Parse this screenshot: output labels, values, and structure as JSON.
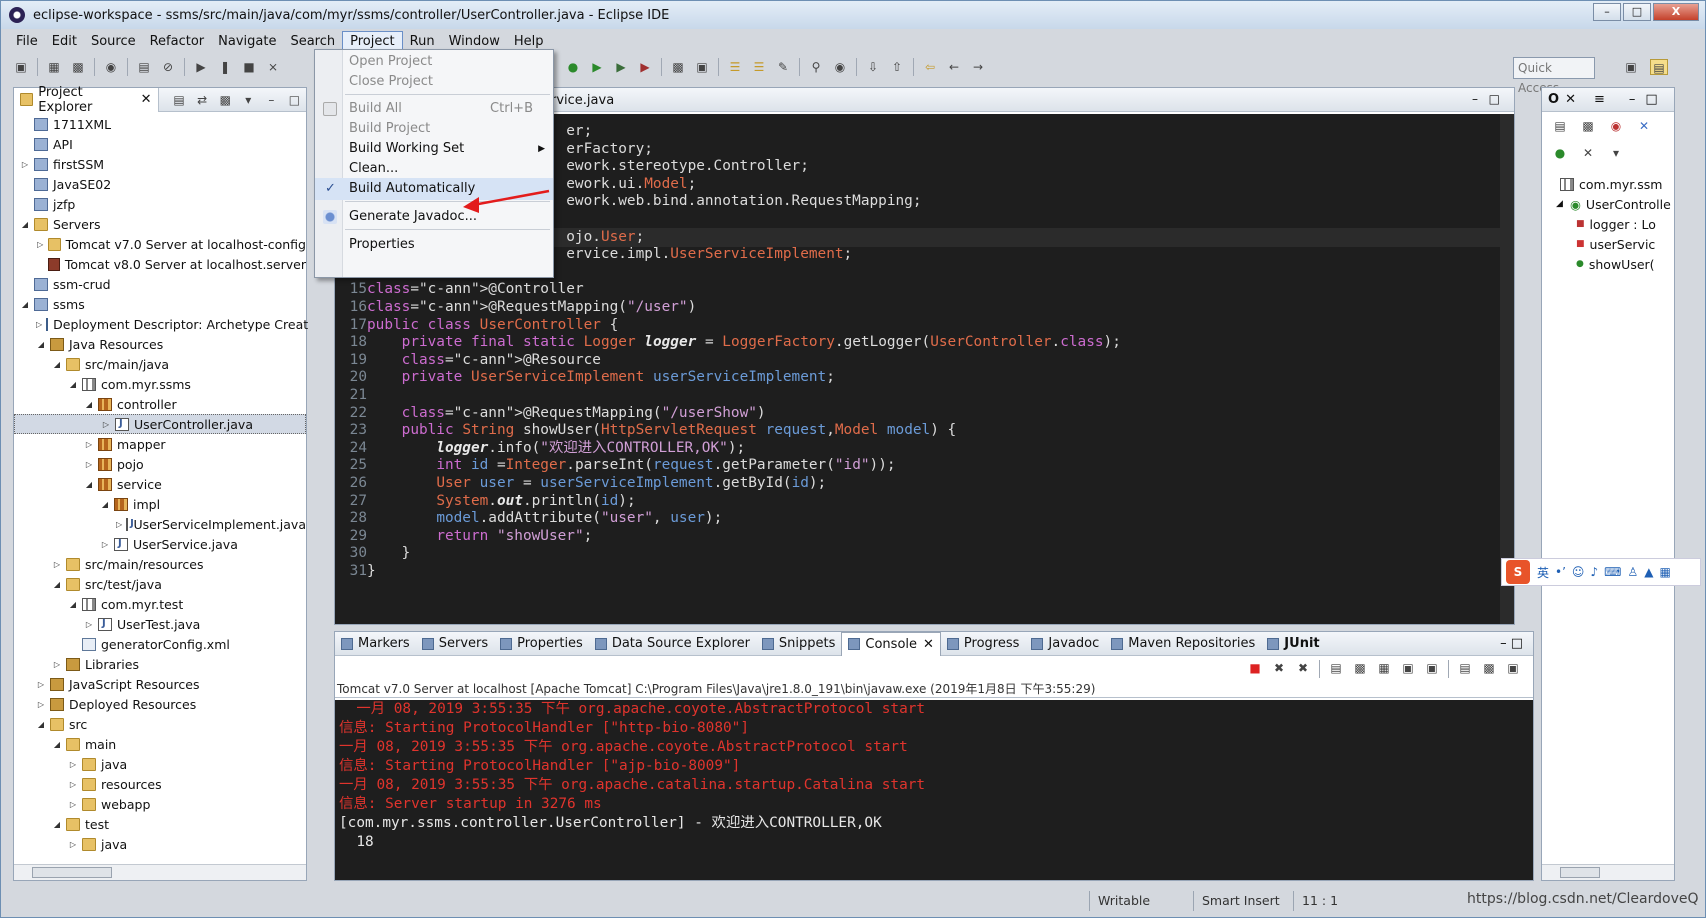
{
  "window": {
    "title": "eclipse-workspace - ssms/src/main/java/com/myr/ssms/controller/UserController.java - Eclipse IDE",
    "buttons": [
      "–",
      "□",
      "X"
    ]
  },
  "menubar": [
    "File",
    "Edit",
    "Source",
    "Refactor",
    "Navigate",
    "Search",
    "Project",
    "Run",
    "Window",
    "Help"
  ],
  "quick_access": "Quick Access",
  "project_menu": {
    "items": [
      {
        "label": "Open Project",
        "disabled": true
      },
      {
        "label": "Close Project",
        "disabled": true
      },
      {
        "label": "Build All",
        "accel": "Ctrl+B",
        "disabled": true
      },
      {
        "label": "Build Project",
        "disabled": true
      },
      {
        "label": "Build Working Set",
        "submenu": true
      },
      {
        "label": "Clean..."
      },
      {
        "label": "Build Automatically",
        "checked": true
      },
      {
        "label": "Generate Javadoc..."
      },
      {
        "label": "Properties"
      }
    ]
  },
  "explorer": {
    "title": "Project Explorer",
    "tree": [
      {
        "label": "1711XML",
        "depth": 0,
        "twisty": "",
        "icon": "project"
      },
      {
        "label": "API",
        "depth": 0,
        "twisty": "",
        "icon": "project"
      },
      {
        "label": "firstSSM",
        "depth": 0,
        "twisty": ">",
        "icon": "project"
      },
      {
        "label": "JavaSE02",
        "depth": 0,
        "twisty": "",
        "icon": "project"
      },
      {
        "label": "jzfp",
        "depth": 0,
        "twisty": "",
        "icon": "project"
      },
      {
        "label": "Servers",
        "depth": 0,
        "twisty": "v",
        "icon": "folder"
      },
      {
        "label": "Tomcat v7.0 Server at localhost-config",
        "depth": 1,
        "twisty": ">",
        "icon": "folder"
      },
      {
        "label": "Tomcat v8.0 Server at localhost.server",
        "depth": 1,
        "twisty": "",
        "icon": "server"
      },
      {
        "label": "ssm-crud",
        "depth": 0,
        "twisty": "",
        "icon": "project"
      },
      {
        "label": "ssms",
        "depth": 0,
        "twisty": "v",
        "icon": "project"
      },
      {
        "label": "Deployment Descriptor: Archetype Creat",
        "depth": 1,
        "twisty": ">",
        "icon": "desc"
      },
      {
        "label": "Java Resources",
        "depth": 1,
        "twisty": "v",
        "icon": "lib"
      },
      {
        "label": "src/main/java",
        "depth": 2,
        "twisty": "v",
        "icon": "folder"
      },
      {
        "label": "com.myr.ssms",
        "depth": 3,
        "twisty": "v",
        "icon": "pkgw"
      },
      {
        "label": "controller",
        "depth": 4,
        "twisty": "v",
        "icon": "pkg"
      },
      {
        "label": "UserController.java",
        "depth": 5,
        "twisty": ">",
        "icon": "java",
        "selected": true
      },
      {
        "label": "mapper",
        "depth": 4,
        "twisty": ">",
        "icon": "pkg"
      },
      {
        "label": "pojo",
        "depth": 4,
        "twisty": ">",
        "icon": "pkg"
      },
      {
        "label": "service",
        "depth": 4,
        "twisty": "v",
        "icon": "pkg"
      },
      {
        "label": "impl",
        "depth": 5,
        "twisty": "v",
        "icon": "pkg"
      },
      {
        "label": "UserServiceImplement.java",
        "depth": 6,
        "twisty": ">",
        "icon": "java"
      },
      {
        "label": "UserService.java",
        "depth": 5,
        "twisty": ">",
        "icon": "java"
      },
      {
        "label": "src/main/resources",
        "depth": 2,
        "twisty": ">",
        "icon": "folder"
      },
      {
        "label": "src/test/java",
        "depth": 2,
        "twisty": "v",
        "icon": "folder"
      },
      {
        "label": "com.myr.test",
        "depth": 3,
        "twisty": "v",
        "icon": "pkgw"
      },
      {
        "label": "UserTest.java",
        "depth": 4,
        "twisty": ">",
        "icon": "java"
      },
      {
        "label": "generatorConfig.xml",
        "depth": 3,
        "twisty": "",
        "icon": "xml"
      },
      {
        "label": "Libraries",
        "depth": 2,
        "twisty": ">",
        "icon": "lib"
      },
      {
        "label": "JavaScript Resources",
        "depth": 1,
        "twisty": ">",
        "icon": "lib"
      },
      {
        "label": "Deployed Resources",
        "depth": 1,
        "twisty": ">",
        "icon": "lib"
      },
      {
        "label": "src",
        "depth": 1,
        "twisty": "v",
        "icon": "folder"
      },
      {
        "label": "main",
        "depth": 2,
        "twisty": "v",
        "icon": "folder"
      },
      {
        "label": "java",
        "depth": 3,
        "twisty": ">",
        "icon": "folder"
      },
      {
        "label": "resources",
        "depth": 3,
        "twisty": ">",
        "icon": "folder"
      },
      {
        "label": "webapp",
        "depth": 3,
        "twisty": ">",
        "icon": "folder"
      },
      {
        "label": "test",
        "depth": 2,
        "twisty": "v",
        "icon": "folder"
      },
      {
        "label": "java",
        "depth": 3,
        "twisty": ">",
        "icon": "folder"
      }
    ]
  },
  "editor": {
    "tab_title": "rvice.java",
    "lines": [
      {
        "n": "",
        "code": "                       er;"
      },
      {
        "n": "",
        "code": "                       erFactory;"
      },
      {
        "n": "",
        "code": "                       ework.stereotype.Controller;"
      },
      {
        "n": "",
        "code": "                       ework.ui.Model;"
      },
      {
        "n": "",
        "code": "                       ework.web.bind.annotation.RequestMapping;"
      },
      {
        "n": "",
        "code": ""
      },
      {
        "n": "",
        "code": "                       ojo.User;"
      },
      {
        "n": "",
        "code": "                       ervice.impl.UserServiceImplement;"
      },
      {
        "n": "14",
        "code": ""
      },
      {
        "n": "15",
        "code": "@Controller"
      },
      {
        "n": "16",
        "code": "@RequestMapping(\"/user\")"
      },
      {
        "n": "17",
        "code": "public class UserController {"
      },
      {
        "n": "18",
        "code": "    private final static Logger logger = LoggerFactory.getLogger(UserController.class);"
      },
      {
        "n": "19",
        "code": "    @Resource"
      },
      {
        "n": "20",
        "code": "    private UserServiceImplement userServiceImplement;"
      },
      {
        "n": "21",
        "code": ""
      },
      {
        "n": "22",
        "code": "    @RequestMapping(\"/userShow\")"
      },
      {
        "n": "23",
        "code": "    public String showUser(HttpServletRequest request,Model model) {"
      },
      {
        "n": "24",
        "code": "        logger.info(\"欢迎进入CONTROLLER,OK\");"
      },
      {
        "n": "25",
        "code": "        int id =Integer.parseInt(request.getParameter(\"id\"));"
      },
      {
        "n": "26",
        "code": "        User user = userServiceImplement.getById(id);"
      },
      {
        "n": "27",
        "code": "        System.out.println(id);"
      },
      {
        "n": "28",
        "code": "        model.addAttribute(\"user\", user);"
      },
      {
        "n": "29",
        "code": "        return \"showUser\";"
      },
      {
        "n": "30",
        "code": "    }"
      },
      {
        "n": "31",
        "code": "}"
      }
    ]
  },
  "outline": {
    "rows": [
      "com.myr.ssm",
      "UserControlle",
      "logger : Lo",
      "userServic",
      "showUser("
    ]
  },
  "console": {
    "tabs": [
      "Markers",
      "Servers",
      "Properties",
      "Data Source Explorer",
      "Snippets",
      "Console",
      "Progress",
      "Javadoc",
      "Maven Repositories",
      "JUnit"
    ],
    "description": "Tomcat v7.0 Server at localhost [Apache Tomcat] C:\\Program Files\\Java\\jre1.8.0_191\\bin\\javaw.exe (2019年1月8日 下午3:55:29)",
    "lines": [
      {
        "text": "  一月 08, 2019 3:55:35 下午 org.apache.coyote.AbstractProtocol start",
        "kind": "err"
      },
      {
        "text": "信息: Starting ProtocolHandler [\"http-bio-8080\"]",
        "kind": "err"
      },
      {
        "text": "一月 08, 2019 3:55:35 下午 org.apache.coyote.AbstractProtocol start",
        "kind": "err"
      },
      {
        "text": "信息: Starting ProtocolHandler [\"ajp-bio-8009\"]",
        "kind": "err"
      },
      {
        "text": "一月 08, 2019 3:55:35 下午 org.apache.catalina.startup.Catalina start",
        "kind": "err"
      },
      {
        "text": "信息: Server startup in 3276 ms",
        "kind": "err"
      },
      {
        "text": "[com.myr.ssms.controller.UserController] - 欢迎进入CONTROLLER,OK",
        "kind": "out"
      },
      {
        "text": "  18",
        "kind": "out"
      }
    ]
  },
  "status": {
    "writable": "Writable",
    "insert_mode": "Smart Insert",
    "position": "11 : 1"
  },
  "watermark": "https://blog.csdn.net/CleardoveQ",
  "ime": {
    "logo": "S",
    "lang": "英"
  }
}
